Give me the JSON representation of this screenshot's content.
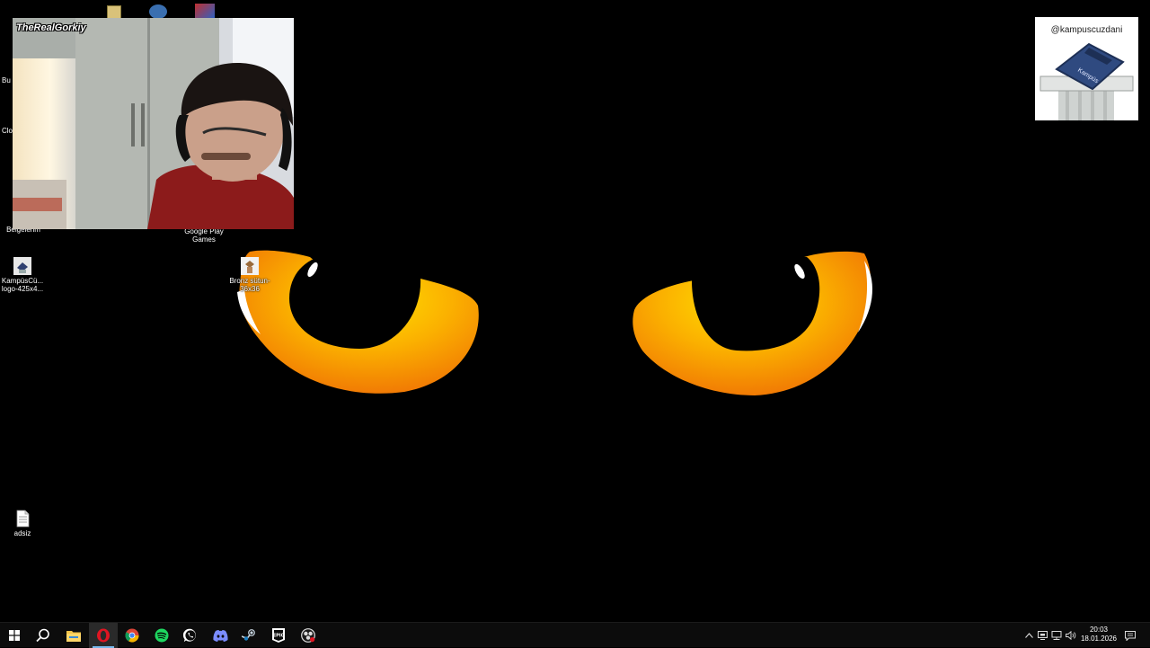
{
  "desktop": {
    "edge_labels": [
      "Bu",
      "Clo"
    ],
    "icons": [
      {
        "label": "Belgelerim"
      },
      {
        "label": "Google Play Games"
      },
      {
        "label": "KampüsCü... logo-425x4..."
      },
      {
        "label": "Bronz sütun-36x36"
      },
      {
        "label": "adsiz"
      }
    ]
  },
  "webcam": {
    "handle": "TheRealGorkiy"
  },
  "brand": {
    "handle": "@kampuscuzdani",
    "stamp_text": "Kampüs"
  },
  "taskbar": {
    "apps": [
      {
        "name": "start",
        "icon": "windows-icon"
      },
      {
        "name": "search",
        "icon": "search-icon"
      },
      {
        "name": "file-explorer",
        "icon": "folder-icon"
      },
      {
        "name": "opera",
        "icon": "opera-icon",
        "active": true
      },
      {
        "name": "chrome",
        "icon": "chrome-icon"
      },
      {
        "name": "spotify",
        "icon": "spotify-icon"
      },
      {
        "name": "whatsapp",
        "icon": "whatsapp-icon"
      },
      {
        "name": "discord",
        "icon": "discord-icon"
      },
      {
        "name": "steam",
        "icon": "steam-icon"
      },
      {
        "name": "epic-games",
        "icon": "epic-games-icon"
      },
      {
        "name": "obs",
        "icon": "obs-icon"
      }
    ],
    "clock": {
      "time": "20:03",
      "date": "18.01.2026"
    }
  },
  "colors": {
    "taskbar_bg": "#0c0c0c",
    "eye_orange": "#f07a10",
    "eye_yellow": "#fcd000",
    "active_indicator": "#76b9ed"
  }
}
